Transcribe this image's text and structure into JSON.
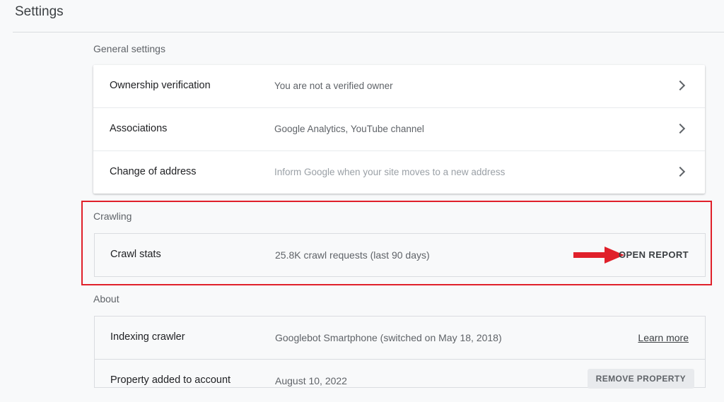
{
  "header": {
    "title": "Settings"
  },
  "general": {
    "label": "General settings",
    "rows": [
      {
        "title": "Ownership verification",
        "value": "You are not a verified owner"
      },
      {
        "title": "Associations",
        "value": "Google Analytics, YouTube channel"
      },
      {
        "title": "Change of address",
        "value": "Inform Google when your site moves to a new address"
      }
    ]
  },
  "crawling": {
    "label": "Crawling",
    "row": {
      "title": "Crawl stats",
      "value": "25.8K crawl requests (last 90 days)",
      "action": "OPEN REPORT"
    }
  },
  "about": {
    "label": "About",
    "rows": [
      {
        "title": "Indexing crawler",
        "value": "Googlebot Smartphone (switched on May 18, 2018)",
        "action": "Learn more"
      },
      {
        "title": "Property added to account",
        "value": "August 10, 2022",
        "action": "REMOVE PROPERTY"
      }
    ]
  },
  "colors": {
    "highlight": "#e0202a",
    "arrow": "#e0202a"
  },
  "icons": {
    "row_action": "chevron-right-icon",
    "annotation": "red-arrow-icon"
  }
}
